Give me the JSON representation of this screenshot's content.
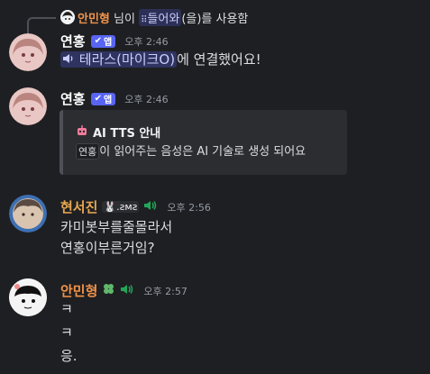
{
  "system": {
    "user": "안민형",
    "prefix": "님이",
    "channel": "들어와",
    "suffix": "(을)를 사용함"
  },
  "messages": [
    {
      "author": "연홍",
      "author_color": "#ffffff",
      "badge": "앱",
      "time": "오후 2:46",
      "mention": "테라스(마이크O)",
      "text": "에 연결했어요!"
    },
    {
      "author": "연홍",
      "author_color": "#ffffff",
      "badge": "앱",
      "time": "오후 2:46",
      "embed": {
        "title": "AI TTS 안내",
        "code": "연홍",
        "text": "이 읽어주는 음성은 AI 기술로 생성 되어요"
      }
    },
    {
      "author": "현서진",
      "author_color": "#e8a852",
      "badge_text": ".ƨᴍƨ",
      "time": "오후 2:56",
      "lines": [
        "카미봇부를줄몰라서",
        "연홍이부른거임?"
      ]
    },
    {
      "author": "안민형",
      "author_color": "#f0934a",
      "time": "오후 2:57",
      "lines": [
        "ㅋ",
        "ㅋ",
        "응."
      ]
    }
  ],
  "colors": {
    "background": "#1e1f22",
    "app_badge": "#5865f2",
    "speaker_green": "#23a55a",
    "mention_bg": "#3c4270"
  }
}
